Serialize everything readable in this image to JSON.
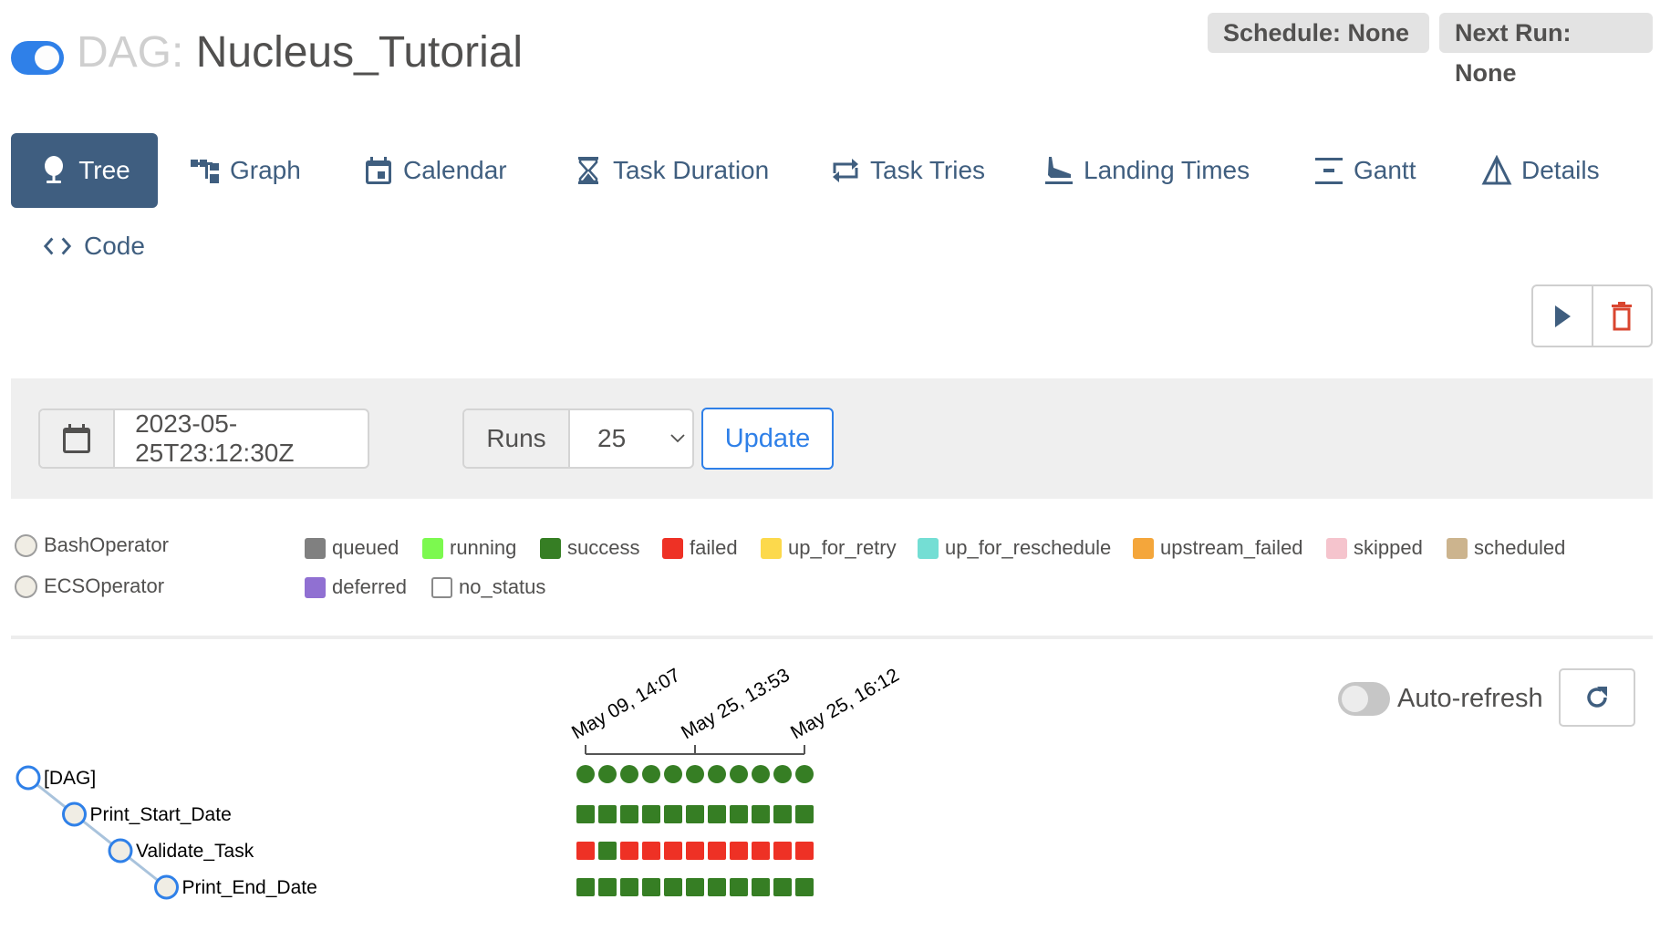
{
  "header": {
    "dag_prefix": "DAG:",
    "dag_name": "Nucleus_Tutorial",
    "paused_toggle_on": true,
    "schedule_badge": "Schedule: None",
    "next_run_badge": "Next Run: None"
  },
  "tabs": [
    {
      "label": "Tree",
      "icon": "tree-icon",
      "active": true
    },
    {
      "label": "Graph",
      "icon": "graph-icon",
      "active": false
    },
    {
      "label": "Calendar",
      "icon": "calendar-icon",
      "active": false
    },
    {
      "label": "Task Duration",
      "icon": "hourglass-icon",
      "active": false
    },
    {
      "label": "Task Tries",
      "icon": "repeat-icon",
      "active": false
    },
    {
      "label": "Landing Times",
      "icon": "plane-landing-icon",
      "active": false
    },
    {
      "label": "Gantt",
      "icon": "gantt-icon",
      "active": false
    },
    {
      "label": "Details",
      "icon": "details-triangle-icon",
      "active": false
    },
    {
      "label": "Code",
      "icon": "code-icon",
      "active": false
    }
  ],
  "actions": {
    "trigger_icon": "play-icon",
    "delete_icon": "trash-icon"
  },
  "form": {
    "base_date_value": "2023-05-25T23:12:30Z",
    "runs_label": "Runs",
    "runs_value": "25",
    "update_label": "Update"
  },
  "operator_legend": [
    {
      "label": "BashOperator"
    },
    {
      "label": "ECSOperator"
    }
  ],
  "state_legend": [
    {
      "label": "queued",
      "color": "#808080"
    },
    {
      "label": "running",
      "color": "#7cf94f"
    },
    {
      "label": "success",
      "color": "#367e24"
    },
    {
      "label": "failed",
      "color": "#ee3125"
    },
    {
      "label": "up_for_retry",
      "color": "#fcd94c"
    },
    {
      "label": "up_for_reschedule",
      "color": "#74ded4"
    },
    {
      "label": "upstream_failed",
      "color": "#f4a63b"
    },
    {
      "label": "skipped",
      "color": "#f5c4cd"
    },
    {
      "label": "scheduled",
      "color": "#ccb48e"
    },
    {
      "label": "deferred",
      "color": "#9070d2"
    },
    {
      "label": "no_status",
      "color": "#ffffff"
    }
  ],
  "auto_refresh": {
    "label": "Auto-refresh",
    "enabled": false
  },
  "tree": {
    "date_labels": [
      "May 09, 14:07",
      "May 25, 13:53",
      "May 25, 16:12"
    ],
    "nodes": [
      {
        "label": "[DAG]",
        "depth": 0,
        "is_dag": true
      },
      {
        "label": "Print_Start_Date",
        "depth": 1,
        "is_dag": false
      },
      {
        "label": "Validate_Task",
        "depth": 2,
        "is_dag": false
      },
      {
        "label": "Print_End_Date",
        "depth": 3,
        "is_dag": false
      }
    ],
    "run_states": [
      [
        "success",
        "success",
        "success",
        "success",
        "success",
        "success",
        "success",
        "success",
        "success",
        "success",
        "success"
      ],
      [
        "success",
        "success",
        "success",
        "success",
        "success",
        "success",
        "success",
        "success",
        "success",
        "success",
        "success"
      ],
      [
        "failed",
        "success",
        "failed",
        "failed",
        "failed",
        "failed",
        "failed",
        "failed",
        "failed",
        "failed",
        "failed"
      ],
      [
        "success",
        "success",
        "success",
        "success",
        "success",
        "success",
        "success",
        "success",
        "success",
        "success",
        "success"
      ]
    ]
  }
}
